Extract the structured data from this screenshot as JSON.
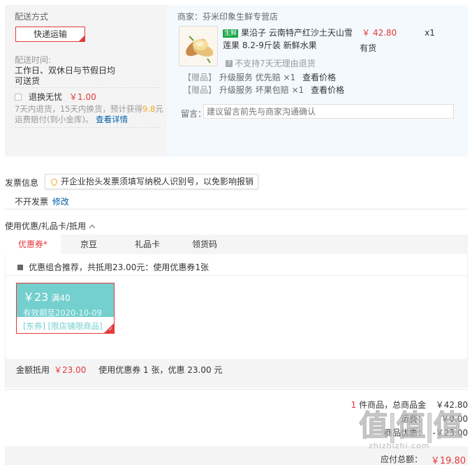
{
  "shipping": {
    "title": "配送方式",
    "method_button": "快递运输",
    "time_label": "配送时间:",
    "time_line1": "工作日、双休日与节假日均",
    "time_line2": "可送货",
    "return_label": "退换无忧",
    "return_price": "￥1.00",
    "return_desc_1": "7天内退货，15天内换货，预计获得",
    "return_desc_amount": "9.8",
    "return_desc_2": "元运费赔付(到小金库)。",
    "return_link": "查看详情"
  },
  "merchant": {
    "name": "商家：芬米印象生鲜专营店",
    "product": {
      "tag": "生鲜",
      "title": "果沿子 云南特产红沙土天山雪莲果 8.2-9斤装 新鲜水果",
      "price": "￥ 42.80",
      "stock": "有货",
      "qty": "x1",
      "no_return": "不支持7天无理由退货"
    },
    "gifts": [
      {
        "tag": "【赠品】",
        "name": "升级服务 优先赔 ×1",
        "view": "查看价格"
      },
      {
        "tag": "【赠品】",
        "name": "升级服务 坏果包赔 ×1",
        "view": "查看价格"
      }
    ],
    "message_label": "留言：",
    "message_placeholder": "建议留言前先与商家沟通确认"
  },
  "invoice": {
    "label": "发票信息",
    "tip": "开企业抬头发票须填写纳税人识别号，以免影响报销",
    "status": "不开发票",
    "edit": "修改"
  },
  "coupons": {
    "header": "使用优惠/礼品卡/抵用",
    "tabs": [
      {
        "label": "优惠券*",
        "active": true
      },
      {
        "label": "京豆",
        "active": false
      },
      {
        "label": "礼品卡",
        "active": false
      },
      {
        "label": "领货码",
        "active": false
      }
    ],
    "combo_text": "优惠组合推荐，共抵用23.00元：使用优惠券1张",
    "card": {
      "amount": "￥23",
      "condition": "满40",
      "expiry": "有效期至2020-10-09",
      "limit": "[东券] [限店铺限商品]"
    },
    "footer_label": "金额抵用",
    "footer_amount": "￥23.00",
    "footer_summary": "使用优惠券 1 张，优惠 23.00 元"
  },
  "totals": {
    "items_count": "1",
    "items_label": " 件商品，总商品金",
    "items_value": "￥42.80",
    "row2_label": "运费：",
    "row2_value": "￥0.00",
    "row3_label": "商品优惠：",
    "row3_value": "-￥23.00",
    "final_label": "应付总额：",
    "final_value": "￥19.80"
  },
  "watermark": {
    "big": "值|值|值",
    "url": "zhizhizhi.com"
  }
}
